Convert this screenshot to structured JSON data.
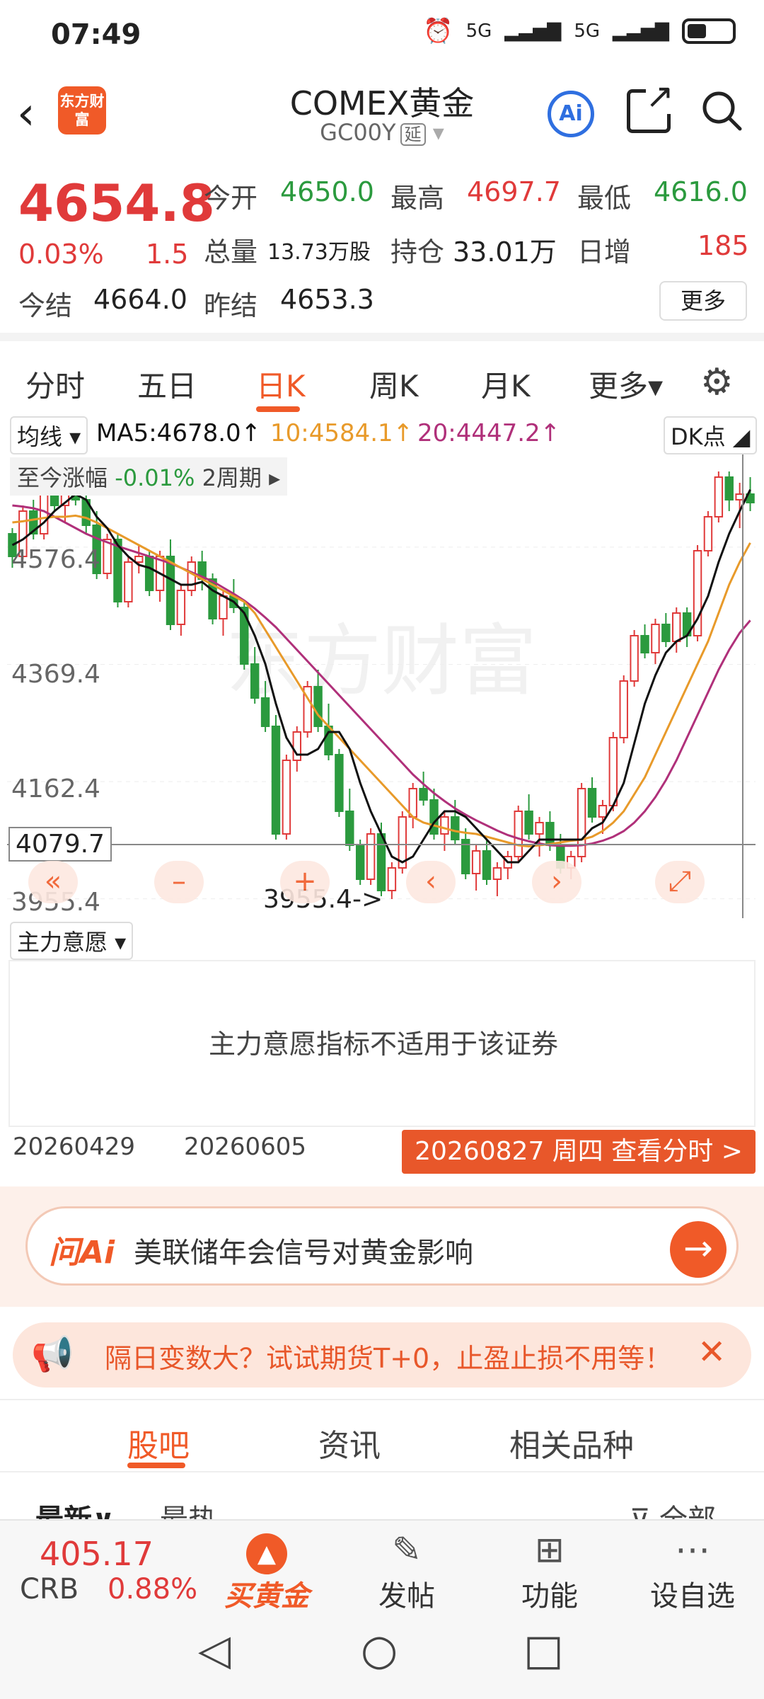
{
  "status": {
    "time": "07:49",
    "signal1": "5G",
    "signal2": "5G"
  },
  "header": {
    "logo_text": "东方财富",
    "title": "COMEX黄金",
    "code": "GC00Y",
    "delay_tag": "延"
  },
  "quote": {
    "price": "4654.8",
    "change_pct": "0.03%",
    "change": "1.5",
    "open_label": "今开",
    "open": "4650.0",
    "high_label": "最高",
    "high": "4697.7",
    "low_label": "最低",
    "low": "4616.0",
    "volume_label": "总量",
    "volume": "13.73万股",
    "oi_label": "持仓",
    "oi": "33.01万",
    "daily_inc_label": "日增",
    "daily_inc": "185",
    "settle_label": "今结",
    "settle": "4664.0",
    "prev_settle_label": "昨结",
    "prev_settle": "4653.3",
    "more": "更多"
  },
  "tabs": [
    {
      "label": "分时",
      "active": false
    },
    {
      "label": "五日",
      "active": false
    },
    {
      "label": "日K",
      "active": true
    },
    {
      "label": "周K",
      "active": false
    },
    {
      "label": "月K",
      "active": false
    },
    {
      "label": "更多▾",
      "active": false
    }
  ],
  "ma_bar": {
    "selector": "均线 ▾",
    "ma5": "MA5:4678.0↑",
    "ma10": "10:4584.1↑",
    "ma20": "20:4447.2↑",
    "dk": "DK点 ◢",
    "colors": {
      "ma5": "#111111",
      "ma10": "#e89a2a",
      "ma20": "#b0307a",
      "up": "#e03a3a",
      "down": "#2b9a3e"
    }
  },
  "chart_overlay": {
    "change_label": "至今涨幅",
    "change_value": "-0.01%",
    "period": "2周期 ▸",
    "watermark": "东方财富",
    "y_ticks": [
      "4576.4",
      "4369.4",
      "4162.4",
      "3955.4"
    ],
    "crosshair_price": "4079.7",
    "low_marker": "3955.4->",
    "controls": [
      "«",
      "–",
      "+",
      "‹",
      "›",
      "⤢"
    ]
  },
  "chart_data": {
    "type": "candlestick",
    "ylim": [
      3940,
      4720
    ],
    "y_ticks": [
      4576.4,
      4369.4,
      4162.4,
      3955.4
    ],
    "x_labels": [
      "20260429",
      "20260605"
    ],
    "candles": [
      [
        4600,
        4610,
        4540,
        4560
      ],
      [
        4560,
        4650,
        4555,
        4640
      ],
      [
        4640,
        4660,
        4590,
        4600
      ],
      [
        4600,
        4700,
        4590,
        4690
      ],
      [
        4690,
        4705,
        4640,
        4650
      ],
      [
        4650,
        4690,
        4620,
        4680
      ],
      [
        4680,
        4700,
        4650,
        4660
      ],
      [
        4660,
        4690,
        4600,
        4615
      ],
      [
        4615,
        4640,
        4520,
        4530
      ],
      [
        4530,
        4600,
        4520,
        4590
      ],
      [
        4590,
        4600,
        4470,
        4480
      ],
      [
        4480,
        4560,
        4470,
        4550
      ],
      [
        4550,
        4580,
        4530,
        4560
      ],
      [
        4560,
        4570,
        4490,
        4500
      ],
      [
        4500,
        4570,
        4480,
        4560
      ],
      [
        4560,
        4590,
        4430,
        4440
      ],
      [
        4440,
        4510,
        4420,
        4500
      ],
      [
        4500,
        4560,
        4490,
        4550
      ],
      [
        4550,
        4570,
        4500,
        4520
      ],
      [
        4520,
        4530,
        4440,
        4450
      ],
      [
        4450,
        4500,
        4420,
        4490
      ],
      [
        4490,
        4520,
        4460,
        4470
      ],
      [
        4470,
        4480,
        4360,
        4370
      ],
      [
        4370,
        4400,
        4300,
        4310
      ],
      [
        4310,
        4340,
        4250,
        4260
      ],
      [
        4260,
        4280,
        4060,
        4070
      ],
      [
        4070,
        4210,
        4060,
        4200
      ],
      [
        4200,
        4260,
        4180,
        4250
      ],
      [
        4250,
        4340,
        4240,
        4330
      ],
      [
        4330,
        4360,
        4250,
        4260
      ],
      [
        4260,
        4300,
        4200,
        4210
      ],
      [
        4210,
        4220,
        4100,
        4110
      ],
      [
        4110,
        4150,
        4040,
        4050
      ],
      [
        4050,
        4060,
        3980,
        3990
      ],
      [
        3990,
        4080,
        3980,
        4070
      ],
      [
        4070,
        4090,
        3960,
        3970
      ],
      [
        3970,
        4020,
        3955,
        4010
      ],
      [
        4010,
        4110,
        4000,
        4100
      ],
      [
        4100,
        4160,
        4080,
        4150
      ],
      [
        4150,
        4180,
        4120,
        4130
      ],
      [
        4130,
        4150,
        4060,
        4070
      ],
      [
        4070,
        4110,
        4040,
        4100
      ],
      [
        4100,
        4130,
        4050,
        4060
      ],
      [
        4060,
        4080,
        3990,
        4000
      ],
      [
        4000,
        4050,
        3970,
        4040
      ],
      [
        4040,
        4060,
        3980,
        3990
      ],
      [
        3990,
        4020,
        3960,
        4010
      ],
      [
        4010,
        4040,
        3990,
        4030
      ],
      [
        4030,
        4120,
        4020,
        4110
      ],
      [
        4110,
        4140,
        4060,
        4070
      ],
      [
        4070,
        4100,
        4030,
        4090
      ],
      [
        4090,
        4110,
        4040,
        4050
      ],
      [
        4050,
        4070,
        4000,
        4010
      ],
      [
        4010,
        4040,
        3990,
        4030
      ],
      [
        4030,
        4160,
        4020,
        4150
      ],
      [
        4150,
        4170,
        4090,
        4100
      ],
      [
        4100,
        4130,
        4070,
        4120
      ],
      [
        4120,
        4250,
        4110,
        4240
      ],
      [
        4240,
        4350,
        4230,
        4340
      ],
      [
        4340,
        4430,
        4330,
        4420
      ],
      [
        4420,
        4440,
        4380,
        4390
      ],
      [
        4390,
        4450,
        4370,
        4440
      ],
      [
        4440,
        4460,
        4400,
        4410
      ],
      [
        4410,
        4470,
        4390,
        4460
      ],
      [
        4460,
        4470,
        4400,
        4420
      ],
      [
        4420,
        4580,
        4410,
        4570
      ],
      [
        4570,
        4640,
        4560,
        4630
      ],
      [
        4630,
        4710,
        4620,
        4700
      ],
      [
        4700,
        4710,
        4640,
        4660
      ],
      [
        4660,
        4690,
        4610,
        4670
      ],
      [
        4670,
        4700,
        4640,
        4655
      ]
    ],
    "ma5": [
      4580,
      4590,
      4605,
      4620,
      4640,
      4655,
      4670,
      4660,
      4630,
      4610,
      4580,
      4560,
      4545,
      4540,
      4530,
      4520,
      4510,
      4510,
      4515,
      4500,
      4490,
      4480,
      4460,
      4420,
      4370,
      4300,
      4240,
      4210,
      4210,
      4220,
      4250,
      4250,
      4220,
      4160,
      4110,
      4070,
      4030,
      4020,
      4030,
      4060,
      4090,
      4110,
      4110,
      4100,
      4080,
      4060,
      4040,
      4020,
      4020,
      4040,
      4060,
      4060,
      4060,
      4060,
      4060,
      4080,
      4090,
      4120,
      4160,
      4230,
      4300,
      4350,
      4390,
      4410,
      4420,
      4450,
      4490,
      4550,
      4600,
      4640,
      4678
    ],
    "ma10": [
      4620,
      4622,
      4625,
      4628,
      4630,
      4630,
      4632,
      4628,
      4620,
      4610,
      4600,
      4590,
      4580,
      4570,
      4560,
      4550,
      4540,
      4530,
      4520,
      4510,
      4500,
      4490,
      4480,
      4460,
      4430,
      4400,
      4370,
      4340,
      4310,
      4280,
      4260,
      4240,
      4220,
      4200,
      4180,
      4160,
      4140,
      4120,
      4100,
      4090,
      4085,
      4080,
      4075,
      4072,
      4070,
      4065,
      4060,
      4055,
      4050,
      4048,
      4050,
      4052,
      4055,
      4058,
      4060,
      4065,
      4075,
      4090,
      4110,
      4140,
      4170,
      4210,
      4250,
      4290,
      4330,
      4370,
      4410,
      4460,
      4510,
      4550,
      4584
    ],
    "ma20": [
      4650,
      4648,
      4645,
      4640,
      4630,
      4620,
      4610,
      4600,
      4592,
      4585,
      4578,
      4572,
      4566,
      4560,
      4554,
      4548,
      4540,
      4532,
      4524,
      4516,
      4505,
      4494,
      4482,
      4468,
      4452,
      4435,
      4415,
      4395,
      4375,
      4355,
      4335,
      4315,
      4295,
      4275,
      4255,
      4235,
      4215,
      4195,
      4175,
      4158,
      4142,
      4128,
      4115,
      4104,
      4094,
      4085,
      4076,
      4068,
      4062,
      4057,
      4053,
      4050,
      4049,
      4049,
      4050,
      4053,
      4058,
      4065,
      4075,
      4090,
      4110,
      4135,
      4165,
      4200,
      4240,
      4280,
      4320,
      4360,
      4395,
      4425,
      4447
    ]
  },
  "indicator": {
    "selector": "主力意愿 ▾",
    "message": "主力意愿指标不适用于该证券"
  },
  "dates": {
    "d1": "20260429",
    "d2": "20260605",
    "pill": "20260827 周四 查看分时 >"
  },
  "ai": {
    "label": "问Ai",
    "prompt": "美联储年会信号对黄金影响"
  },
  "promo": {
    "text": "隔日变数大？试试期货T+0，止盈止损不用等！"
  },
  "sections": [
    {
      "label": "股吧",
      "active": true
    },
    {
      "label": "资讯",
      "active": false
    },
    {
      "label": "相关品种",
      "active": false
    }
  ],
  "peek": {
    "latest": "最新∨",
    "hot": "最热",
    "all": "全部"
  },
  "bottom": {
    "crb_value": "405.17",
    "crb_name": "CRB",
    "crb_pct": "0.88%",
    "buy_gold": "买黄金",
    "post": "发帖",
    "func": "功能",
    "watch": "设自选"
  }
}
